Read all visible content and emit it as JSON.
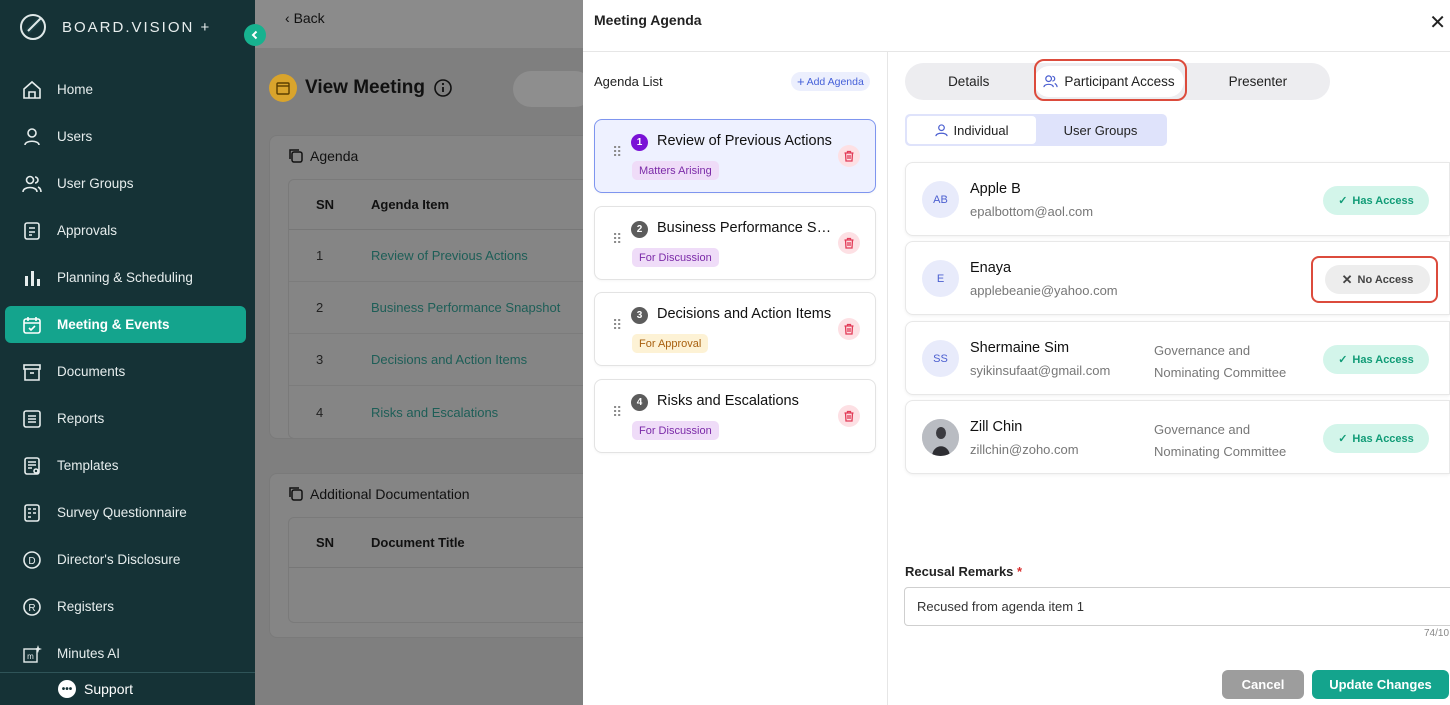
{
  "brand": {
    "name": "BOARD.VISION +"
  },
  "sidebar": {
    "items": [
      {
        "label": "Home",
        "icon": "home-icon"
      },
      {
        "label": "Users",
        "icon": "user-icon"
      },
      {
        "label": "User Groups",
        "icon": "users-icon"
      },
      {
        "label": "Approvals",
        "icon": "clipboard-icon"
      },
      {
        "label": "Planning & Scheduling",
        "icon": "bar-chart-icon"
      },
      {
        "label": "Meeting & Events",
        "icon": "calendar-icon",
        "active": true
      },
      {
        "label": "Documents",
        "icon": "archive-icon"
      },
      {
        "label": "Reports",
        "icon": "list-icon"
      },
      {
        "label": "Templates",
        "icon": "template-icon"
      },
      {
        "label": "Survey Questionnaire",
        "icon": "survey-icon"
      },
      {
        "label": "Director's Disclosure",
        "icon": "d-circle-icon"
      },
      {
        "label": "Registers",
        "icon": "r-circle-icon"
      },
      {
        "label": "Minutes AI",
        "icon": "minutes-ai-icon"
      }
    ],
    "support": "Support"
  },
  "background": {
    "back": "Back",
    "page_title": "View Meeting",
    "agenda_card": {
      "title": "Agenda",
      "headers": [
        "SN",
        "Agenda Item"
      ],
      "rows": [
        {
          "sn": "1",
          "item": "Review of Previous Actions"
        },
        {
          "sn": "2",
          "item": "Business Performance Snapshot"
        },
        {
          "sn": "3",
          "item": "Decisions and Action Items"
        },
        {
          "sn": "4",
          "item": "Risks and Escalations"
        }
      ]
    },
    "docs_card": {
      "title": "Additional Documentation",
      "headers": [
        "SN",
        "Document Title"
      ]
    }
  },
  "modal": {
    "title": "Meeting Agenda",
    "agenda_list_title": "Agenda List",
    "add_agenda": "Add Agenda",
    "agenda_items": [
      {
        "num": "1",
        "title": "Review of Previous Actions",
        "tag": "Matters Arising",
        "tag_style": "purple"
      },
      {
        "num": "2",
        "title": "Business Performance Snapshot",
        "tag": "For Discussion",
        "tag_style": "purple"
      },
      {
        "num": "3",
        "title": "Decisions and Action Items",
        "tag": "For Approval",
        "tag_style": "yellow"
      },
      {
        "num": "4",
        "title": "Risks and Escalations",
        "tag": "For Discussion",
        "tag_style": "purple"
      }
    ],
    "tabs": {
      "details": "Details",
      "participant_access": "Participant Access",
      "presenter": "Presenter"
    },
    "segment": {
      "individual": "Individual",
      "user_groups": "User Groups"
    },
    "participants": [
      {
        "initials": "AB",
        "name": "Apple B",
        "email": "epalbottom@aol.com",
        "group": "",
        "access": "Has Access"
      },
      {
        "initials": "E",
        "name": "Enaya",
        "email": "applebeanie@yahoo.com",
        "group": "",
        "access": "No Access"
      },
      {
        "initials": "SS",
        "name": "Shermaine Sim",
        "email": "syikinsufaat@gmail.com",
        "group": "Governance and Nominating Committee",
        "access": "Has Access"
      },
      {
        "initials": "",
        "name": "Zill Chin",
        "email": "zillchin@zoho.com",
        "group": "Governance and Nominating Committee",
        "access": "Has Access"
      }
    ],
    "recusal": {
      "label": "Recusal Remarks",
      "required": "*",
      "value": "Recused from agenda item 1",
      "counter": "74/10"
    },
    "buttons": {
      "cancel": "Cancel",
      "update": "Update Changes"
    }
  },
  "colors": {
    "sidebar": "#153236",
    "accent": "#14a48d",
    "highlight": "#dc4b3c"
  }
}
